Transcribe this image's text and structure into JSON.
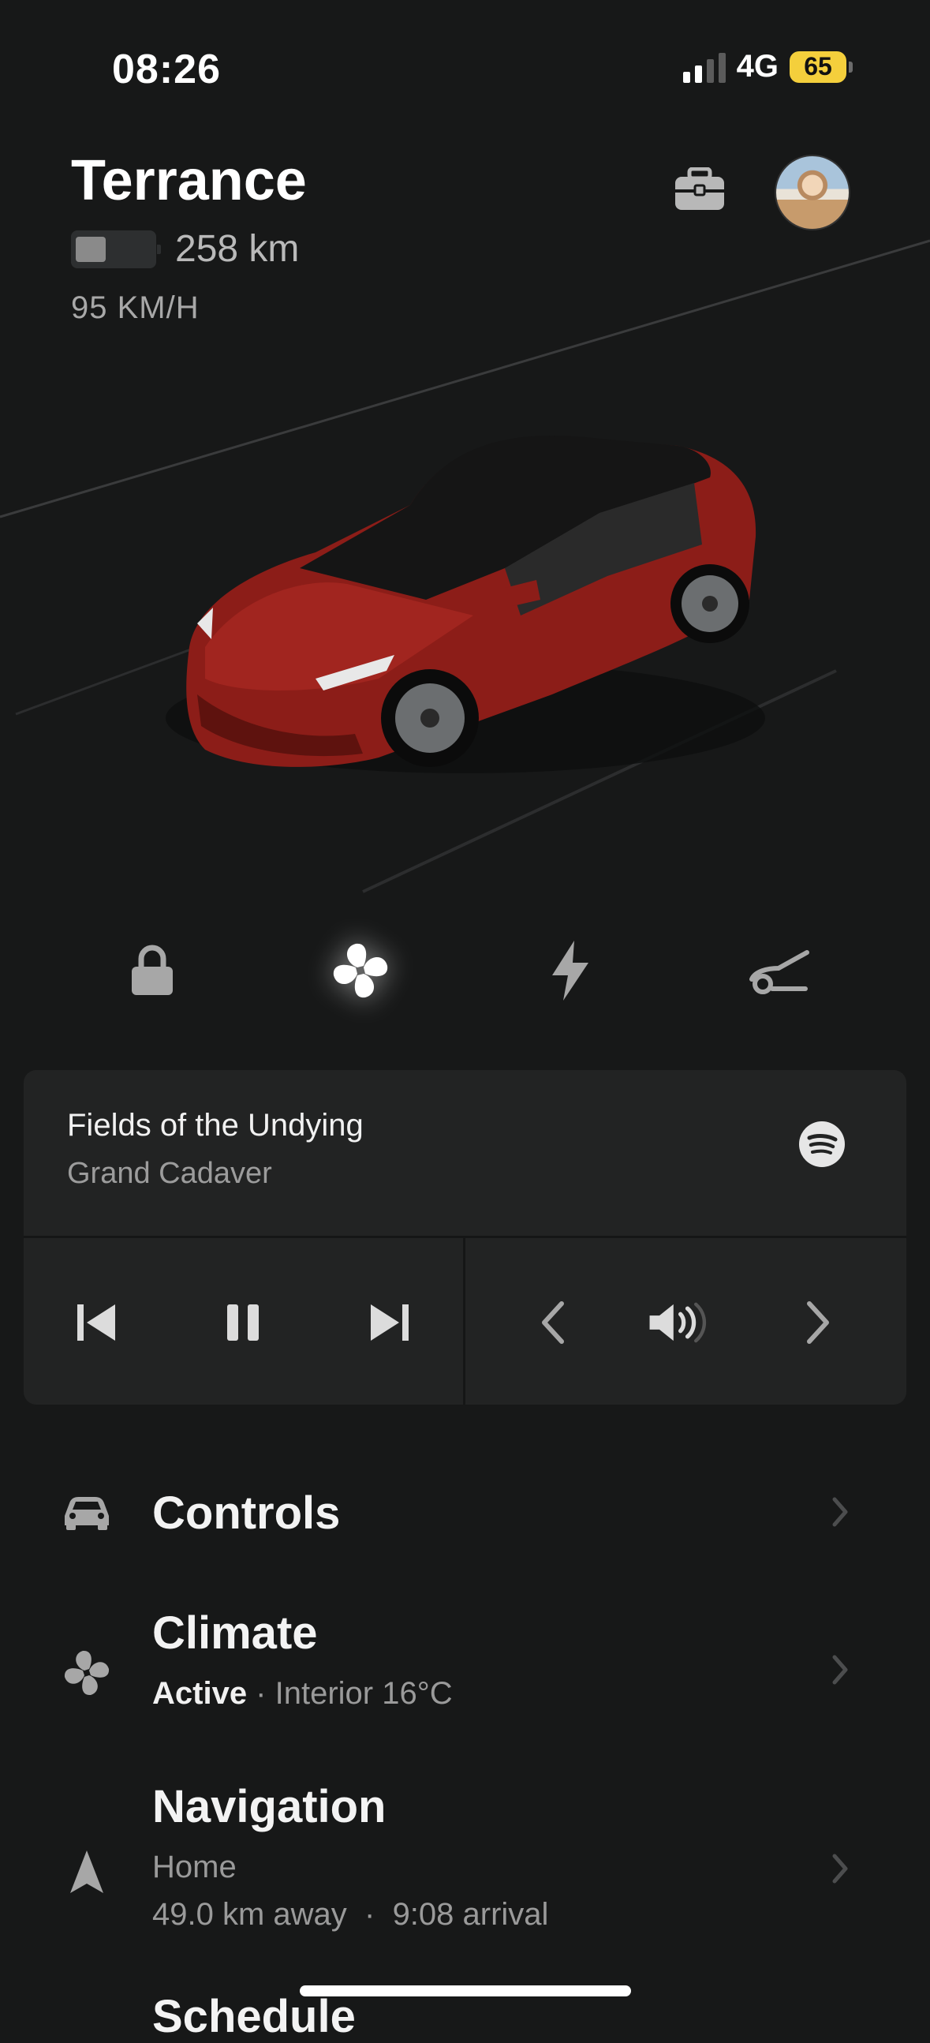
{
  "status_bar": {
    "time": "08:26",
    "network": "4G",
    "battery": "65"
  },
  "header": {
    "car_name": "Terrance",
    "range": "258 km",
    "speed": "95 KM/H",
    "battery_level": 0.4
  },
  "media": {
    "song": "Fields of the Undying",
    "artist": "Grand Cadaver",
    "source_icon": "spotify-icon"
  },
  "menu": {
    "controls": {
      "title": "Controls",
      "icon": "car-icon"
    },
    "climate": {
      "title": "Climate",
      "status": "Active",
      "separator": " · ",
      "detail": "Interior 16°C",
      "icon": "fan-icon"
    },
    "navigation": {
      "title": "Navigation",
      "destination": "Home",
      "distance": "49.0 km away",
      "separator": "  ·  ",
      "arrival": "9:08 arrival",
      "icon": "navigation-arrow-icon"
    },
    "schedule": {
      "title": "Schedule"
    }
  },
  "colors": {
    "background": "#171818",
    "card": "#222323",
    "car_body": "#8c1d18",
    "battery_badge": "#f4cf3c"
  }
}
